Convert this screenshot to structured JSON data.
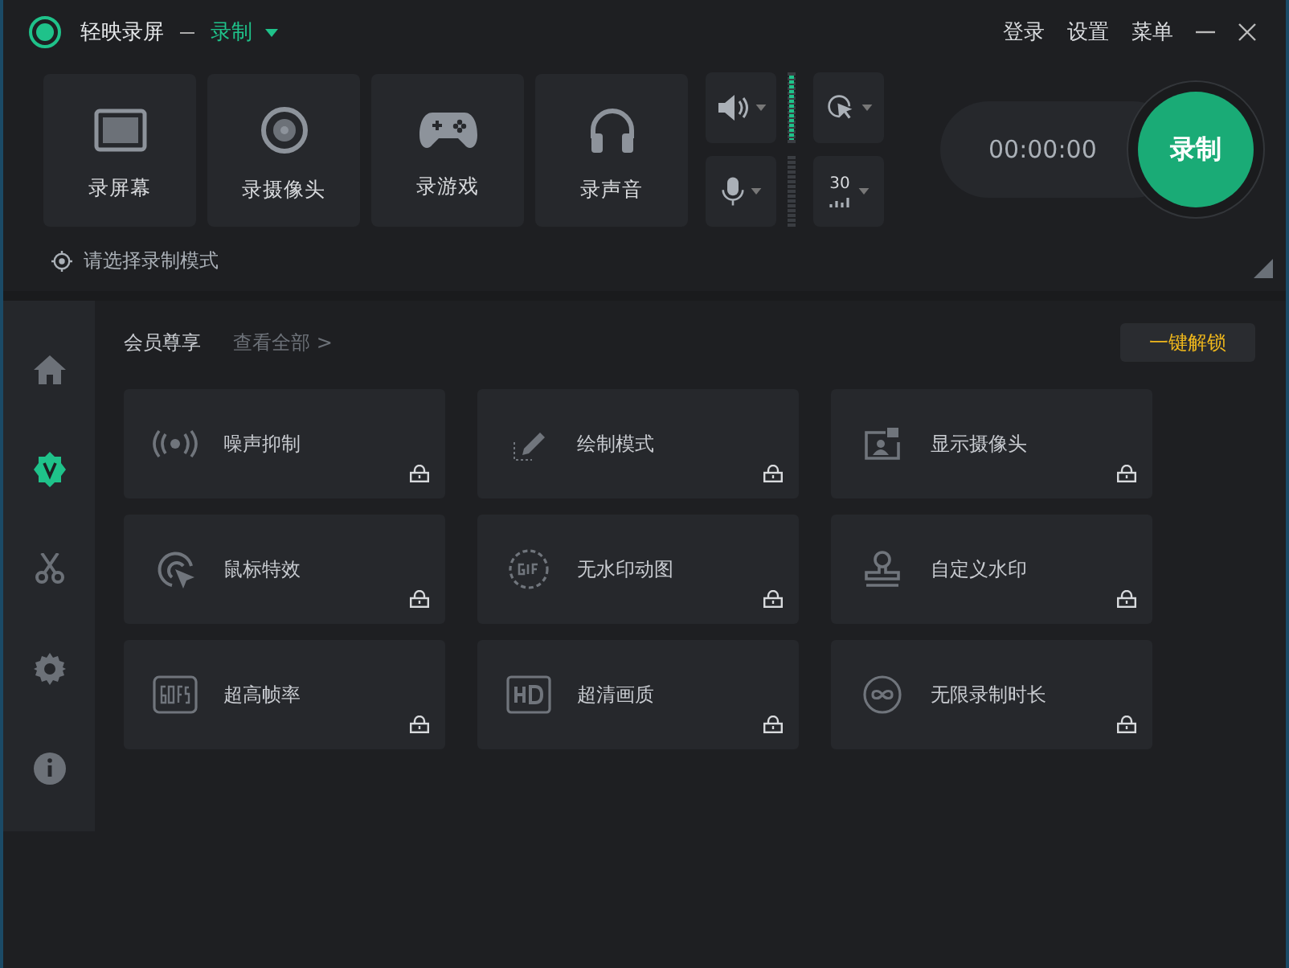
{
  "window": {
    "title": "轻映录屏",
    "mode": "录制",
    "menu": [
      "登录",
      "设置",
      "菜单"
    ]
  },
  "sources": [
    {
      "kind": "screen",
      "label": "录屏幕"
    },
    {
      "kind": "camera",
      "label": "录摄像头"
    },
    {
      "kind": "game",
      "label": "录游戏"
    },
    {
      "kind": "audio",
      "label": "录声音"
    }
  ],
  "audio": [
    {
      "kind": "speaker",
      "level": 1
    },
    {
      "kind": "mic"
    }
  ],
  "options": [
    {
      "kind": "cursor"
    },
    {
      "kind": "fps",
      "value": "30"
    }
  ],
  "timer": "00:00:00",
  "record_button": "录制",
  "mode_hint": "请选择录制模式",
  "sidebar": [
    {
      "kind": "home",
      "selected": false
    },
    {
      "kind": "vip",
      "selected": true
    },
    {
      "kind": "cut",
      "selected": false
    },
    {
      "kind": "settings",
      "selected": false
    },
    {
      "kind": "info",
      "selected": false
    }
  ],
  "members": {
    "title": "会员尊享",
    "view_all": "查看全部 >",
    "unlock_button": "一键解锁",
    "features": [
      {
        "kind": "noise",
        "label": "噪声抑制",
        "locked": true
      },
      {
        "kind": "draw",
        "label": "绘制模式",
        "locked": true
      },
      {
        "kind": "webcam",
        "label": "显示摄像头",
        "locked": true
      },
      {
        "kind": "cursor",
        "label": "鼠标特效",
        "locked": true
      },
      {
        "kind": "gif",
        "label": "无水印动图",
        "locked": true
      },
      {
        "kind": "stamp",
        "label": "自定义水印",
        "locked": true
      },
      {
        "kind": "fps",
        "label": "超高帧率",
        "locked": true
      },
      {
        "kind": "hd",
        "label": "超清画质",
        "locked": true
      },
      {
        "kind": "infinite",
        "label": "无限录制时长",
        "locked": true
      }
    ]
  }
}
